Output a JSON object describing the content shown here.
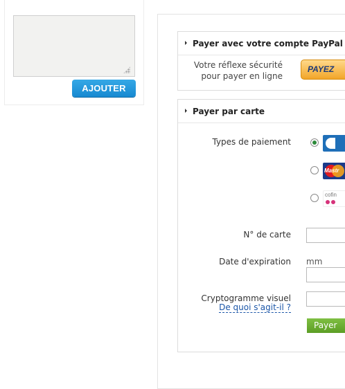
{
  "left": {
    "textarea_value": "",
    "add_button": "AJOUTER"
  },
  "paypal": {
    "title": "Payer avec votre compte PayPal",
    "desc_line1": "Votre réflexe sécurité",
    "desc_line2": "pour payer en ligne",
    "button_label": "PAYEZ"
  },
  "card": {
    "title": "Payer par carte",
    "payment_types_label": "Types de paiement",
    "payment_options": [
      {
        "name": "CB",
        "icon": "cb-card-icon",
        "selected": true
      },
      {
        "name": "MasterCard",
        "icon": "mastercard-icon",
        "selected": false,
        "logo_text": "Mastr"
      },
      {
        "name": "Cofinoga",
        "icon": "cofinoga-icon",
        "selected": false,
        "logo_text": "cofin"
      }
    ],
    "card_number_label": "N° de carte",
    "expiry_label": "Date d'expiration",
    "expiry_month_placeholder": "mm",
    "cvv_label": "Cryptogramme visuel",
    "cvv_help_link": "De quoi s'agit-il ?",
    "pay_button": "Payer"
  },
  "colors": {
    "accent_blue": "#1789d1",
    "pay_green": "#5c9e25",
    "paypal_orange": "#f2a529",
    "link_blue": "#1b56a8"
  }
}
